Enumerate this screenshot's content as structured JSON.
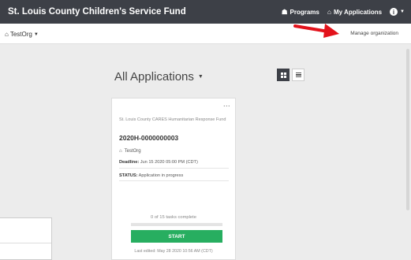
{
  "header": {
    "brand": "St. Louis County Children's Service Fund",
    "nav": [
      {
        "icon": "programs-icon",
        "label": "Programs"
      },
      {
        "icon": "home-icon",
        "label": "My Applications"
      }
    ],
    "help_icon": "info-icon"
  },
  "subheader": {
    "org_name": "TestOrg",
    "manage_label": "Manage organization"
  },
  "annotation": {
    "arrow_color": "#e3121b"
  },
  "main": {
    "title": "All Applications",
    "view_toggle": {
      "selected": "grid",
      "options": [
        "grid",
        "list"
      ]
    }
  },
  "card": {
    "menu": "...",
    "fund_name": "St. Louis County CARES Humanitarian Response Fund",
    "app_id": "2020H-0000000003",
    "org": "TestOrg",
    "deadline_label": "Deadline:",
    "deadline_value": "Jun 15 2020 05:00 PM (CDT)",
    "status_label": "STATUS:",
    "status_value": "Application in progress",
    "progress": {
      "text": "0 of 15 tasks complete",
      "completed": 0,
      "total": 15
    },
    "start_label": "START",
    "last_edited": "Last edited: May 28 2020 10:56 AM (CDT)"
  },
  "colors": {
    "topbar": "#3d4047",
    "accent_green": "#27ae60",
    "background": "#ececec"
  }
}
